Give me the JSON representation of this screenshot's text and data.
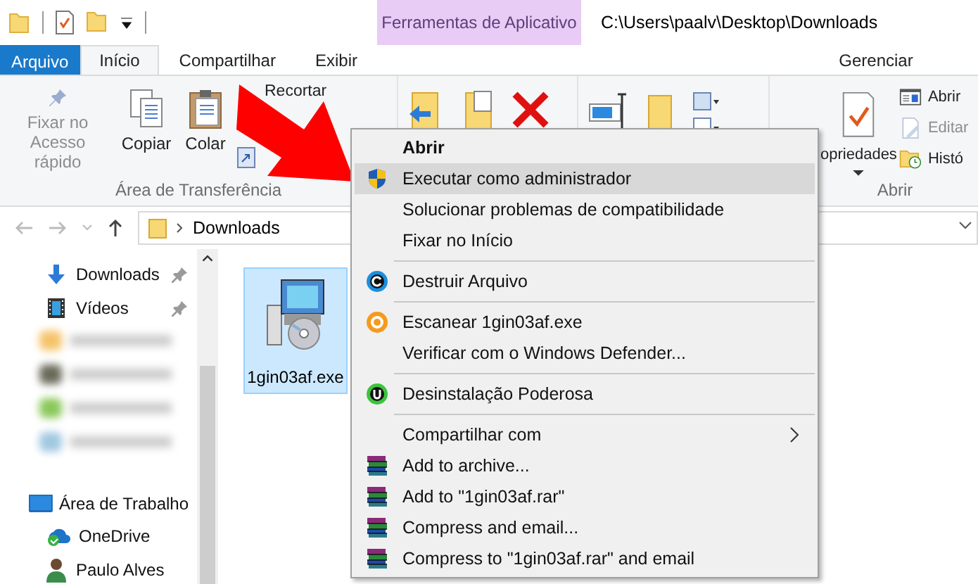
{
  "contextual_tab": {
    "title": "Ferramentas de Aplicativo",
    "tab": {
      "label": "Gerenciar",
      "selected": false
    }
  },
  "path": "C:\\Users\\paalv\\Desktop\\Downloads",
  "tabs": [
    {
      "label": "Arquivo",
      "kind": "file",
      "selected": false
    },
    {
      "label": "Início",
      "kind": "tab",
      "selected": true
    },
    {
      "label": "Compartilhar",
      "kind": "tab",
      "selected": false
    },
    {
      "label": "Exibir",
      "kind": "tab",
      "selected": false
    }
  ],
  "ribbon": {
    "clipboard": {
      "group": "Área de Transferência",
      "buttons": [
        {
          "label": "Fixar no Acesso rápido",
          "disabled": true
        },
        {
          "label": "Copiar",
          "disabled": false
        },
        {
          "label": "Colar",
          "disabled": false
        }
      ],
      "small": [
        "Recortar"
      ]
    },
    "open": {
      "group": "Abrir",
      "properties": "opriedades",
      "items": [
        {
          "label": "Abrir",
          "disabled": false
        },
        {
          "label": "Editar",
          "disabled": true
        },
        {
          "label": "Histó",
          "disabled": false
        }
      ]
    }
  },
  "address": {
    "crumb": "Downloads"
  },
  "sidebar": {
    "items": [
      {
        "kind": "download",
        "label": "Downloads",
        "pinned": true
      },
      {
        "kind": "video",
        "label": "Vídeos",
        "pinned": true
      },
      {
        "kind": "blurred"
      },
      {
        "kind": "blurred"
      },
      {
        "kind": "blurred"
      },
      {
        "kind": "blurred"
      },
      {
        "kind": "desktop",
        "label": "Área de Trabalho",
        "pinned": false
      },
      {
        "kind": "cloud",
        "label": "OneDrive",
        "pinned": false
      },
      {
        "kind": "user",
        "label": "Paulo Alves",
        "pinned": false
      }
    ]
  },
  "files": [
    {
      "name": "1gin03af.exe",
      "selected": true
    }
  ],
  "context_menu": {
    "items": [
      {
        "kind": "plain",
        "label": "Abrir",
        "default": true,
        "selected": false
      },
      {
        "kind": "shield",
        "label": "Executar como administrador",
        "selected": true
      },
      {
        "kind": "plain",
        "label": "Solucionar problemas de compatibilidade",
        "selected": false
      },
      {
        "kind": "plain",
        "label": "Fixar no Início",
        "selected": false
      },
      {
        "kind": "separator"
      },
      {
        "kind": "shred",
        "label": "Destruir Arquivo",
        "selected": false
      },
      {
        "kind": "separator"
      },
      {
        "kind": "scan",
        "label": "Escanear 1gin03af.exe",
        "selected": false
      },
      {
        "kind": "plain",
        "label": "Verificar com o Windows Defender...",
        "selected": false
      },
      {
        "kind": "separator"
      },
      {
        "kind": "uninstall",
        "label": "Desinstalação Poderosa",
        "selected": false
      },
      {
        "kind": "separator"
      },
      {
        "kind": "plain",
        "label": "Compartilhar com",
        "submenu": true,
        "selected": false
      },
      {
        "kind": "archive",
        "label": "Add to archive...",
        "selected": false
      },
      {
        "kind": "archive",
        "label": "Add to \"1gin03af.rar\"",
        "selected": false
      },
      {
        "kind": "archive",
        "label": "Compress and email...",
        "selected": false
      },
      {
        "kind": "archive",
        "label": "Compress to \"1gin03af.rar\" and email",
        "selected": false
      }
    ]
  }
}
